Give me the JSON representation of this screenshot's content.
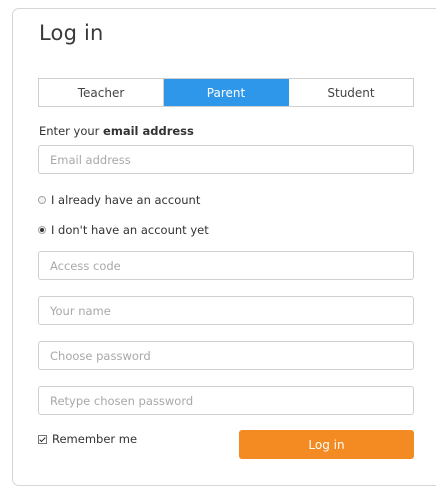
{
  "title": "Log in",
  "tabs": [
    {
      "label": "Teacher",
      "active": false
    },
    {
      "label": "Parent",
      "active": true
    },
    {
      "label": "Student",
      "active": false
    }
  ],
  "email": {
    "label_prefix": "Enter your ",
    "label_bold": "email address",
    "placeholder": "Email address",
    "value": ""
  },
  "account_options": {
    "existing": {
      "label": "I already have an account",
      "checked": false
    },
    "new": {
      "label": "I don't have an account yet",
      "checked": true
    }
  },
  "fields": {
    "access_code": {
      "placeholder": "Access code",
      "value": ""
    },
    "name": {
      "placeholder": "Your name",
      "value": ""
    },
    "password": {
      "placeholder": "Choose password",
      "value": ""
    },
    "password_confirm": {
      "placeholder": "Retype chosen password",
      "value": ""
    }
  },
  "remember": {
    "label": "Remember me",
    "checked": true
  },
  "login_button": {
    "label": "Log in"
  },
  "colors": {
    "accent_tab": "#2f97e9",
    "login_button": "#f48a22"
  }
}
